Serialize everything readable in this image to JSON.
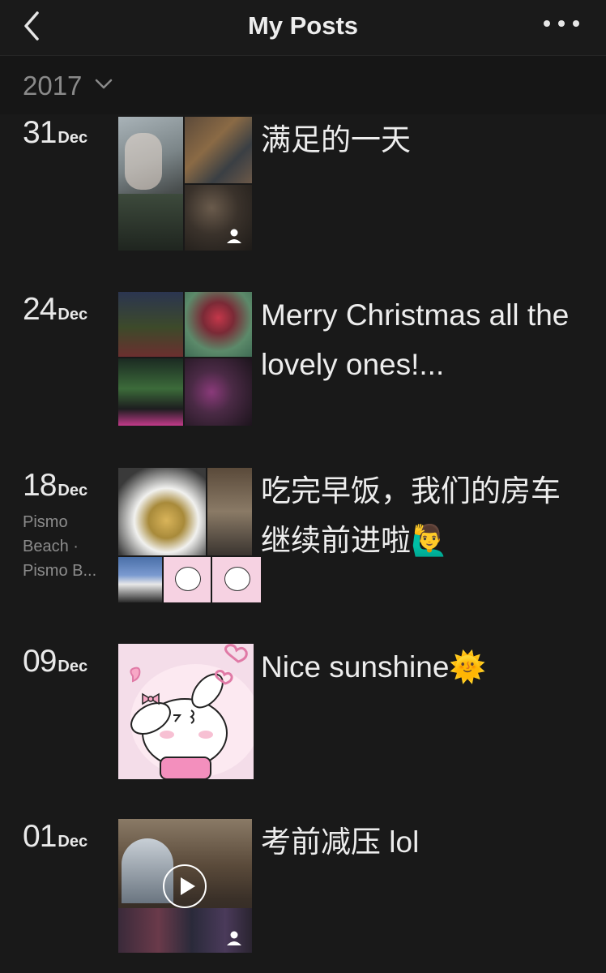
{
  "nav": {
    "title": "My Posts",
    "back_icon": "chevron-left-icon",
    "more_icon": "more-dots-icon"
  },
  "year_selector": {
    "year": "2017",
    "icon": "chevron-down-icon"
  },
  "posts": [
    {
      "day": "31",
      "month": "Dec",
      "text": "满足的一天",
      "location": []
    },
    {
      "day": "24",
      "month": "Dec",
      "text": "Merry Christmas all the lovely ones!...",
      "location": []
    },
    {
      "day": "18",
      "month": "Dec",
      "text": "吃完早饭，我们的房车继续前进啦🙋‍♂️",
      "location": [
        "Pismo",
        "Beach ·",
        "Pismo B..."
      ]
    },
    {
      "day": "09",
      "month": "Dec",
      "text": "Nice sunshine🌞",
      "location": []
    },
    {
      "day": "01",
      "month": "Dec",
      "text": "考前减压 lol",
      "location": []
    }
  ]
}
